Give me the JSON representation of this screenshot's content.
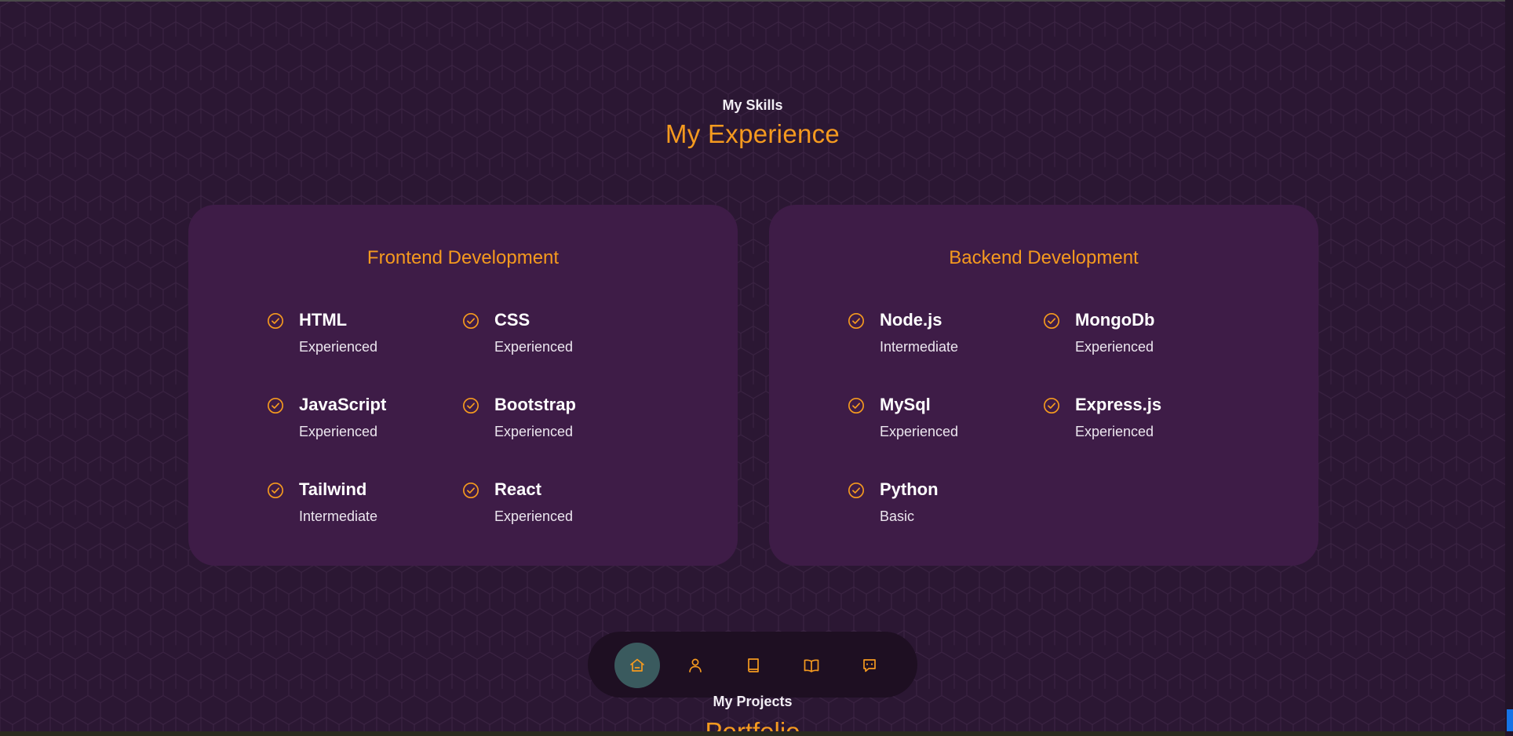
{
  "skills_section": {
    "subtitle": "My Skills",
    "title": "My Experience"
  },
  "frontend": {
    "title": "Frontend Development",
    "items": [
      {
        "name": "HTML",
        "level": "Experienced"
      },
      {
        "name": "CSS",
        "level": "Experienced"
      },
      {
        "name": "JavaScript",
        "level": "Experienced"
      },
      {
        "name": "Bootstrap",
        "level": "Experienced"
      },
      {
        "name": "Tailwind",
        "level": "Intermediate"
      },
      {
        "name": "React",
        "level": "Experienced"
      }
    ]
  },
  "backend": {
    "title": "Backend Development",
    "items": [
      {
        "name": "Node.js",
        "level": "Intermediate"
      },
      {
        "name": "MongoDb",
        "level": "Experienced"
      },
      {
        "name": "MySql",
        "level": "Experienced"
      },
      {
        "name": "Express.js",
        "level": "Experienced"
      },
      {
        "name": "Python",
        "level": "Basic"
      }
    ]
  },
  "nav_dock": {
    "items": [
      {
        "icon": "home-icon",
        "active": true
      },
      {
        "icon": "user-icon",
        "active": false
      },
      {
        "icon": "book-icon",
        "active": false
      },
      {
        "icon": "open-book-icon",
        "active": false
      },
      {
        "icon": "chat-icon",
        "active": false
      }
    ]
  },
  "projects_section": {
    "subtitle": "My Projects",
    "title": "Portfolio"
  },
  "colors": {
    "background": "#2b1733",
    "card": "#3e1c47",
    "accent": "#f59a1f",
    "dock": "#1e0f22",
    "dock_active": "#3a5a5e"
  }
}
